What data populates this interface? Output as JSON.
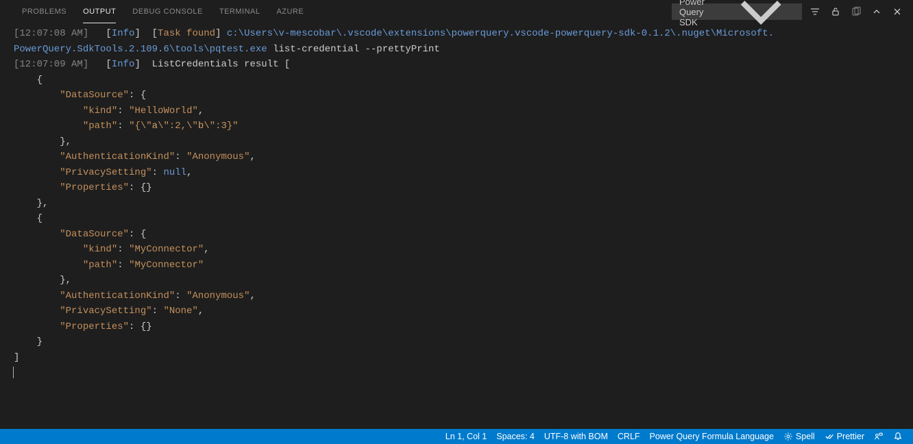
{
  "panel": {
    "tabs": {
      "problems": "Problems",
      "output": "Output",
      "debug_console": "Debug Console",
      "terminal": "Terminal",
      "azure": "Azure"
    },
    "filter_label": "Power Query SDK"
  },
  "output": {
    "line1": {
      "timestamp": "[12:07:08 AM]",
      "level": "Info",
      "task": "Task found",
      "path1": "c:\\Users\\v-mescobar\\.vscode\\extensions\\powerquery.vscode-powerquery-sdk-0.1.2\\.nuget\\Microsoft.",
      "path2": "PowerQuery.SdkTools.2.109.6\\tools\\pqtest.exe",
      "args": " list-credential --prettyPrint"
    },
    "line2": {
      "timestamp": "[12:07:09 AM]",
      "level": "Info",
      "text": "  ListCredentials result ["
    },
    "json": {
      "ds_key": "\"DataSource\"",
      "kind_key": "\"kind\"",
      "path_key": "\"path\"",
      "auth_key": "\"AuthenticationKind\"",
      "priv_key": "\"PrivacySetting\"",
      "props_key": "\"Properties\"",
      "obj0": {
        "kind_val": "\"HelloWorld\"",
        "path_val_a": "\"{\\\"",
        "path_val_a2": "a",
        "path_val_b": "\\\":2,\\\"",
        "path_val_b2": "b",
        "path_val_c": "\\\":3}\"",
        "auth_val": "\"Anonymous\"",
        "priv_val": "null"
      },
      "obj1": {
        "kind_val": "\"MyConnector\"",
        "path_val": "\"MyConnector\"",
        "auth_val": "\"Anonymous\"",
        "priv_val": "\"None\""
      }
    }
  },
  "statusbar": {
    "cursor": "Ln 1, Col 1",
    "spaces": "Spaces: 4",
    "encoding": "UTF-8 with BOM",
    "eol": "CRLF",
    "language": "Power Query Formula Language",
    "spell": "Spell",
    "prettier": "Prettier"
  }
}
